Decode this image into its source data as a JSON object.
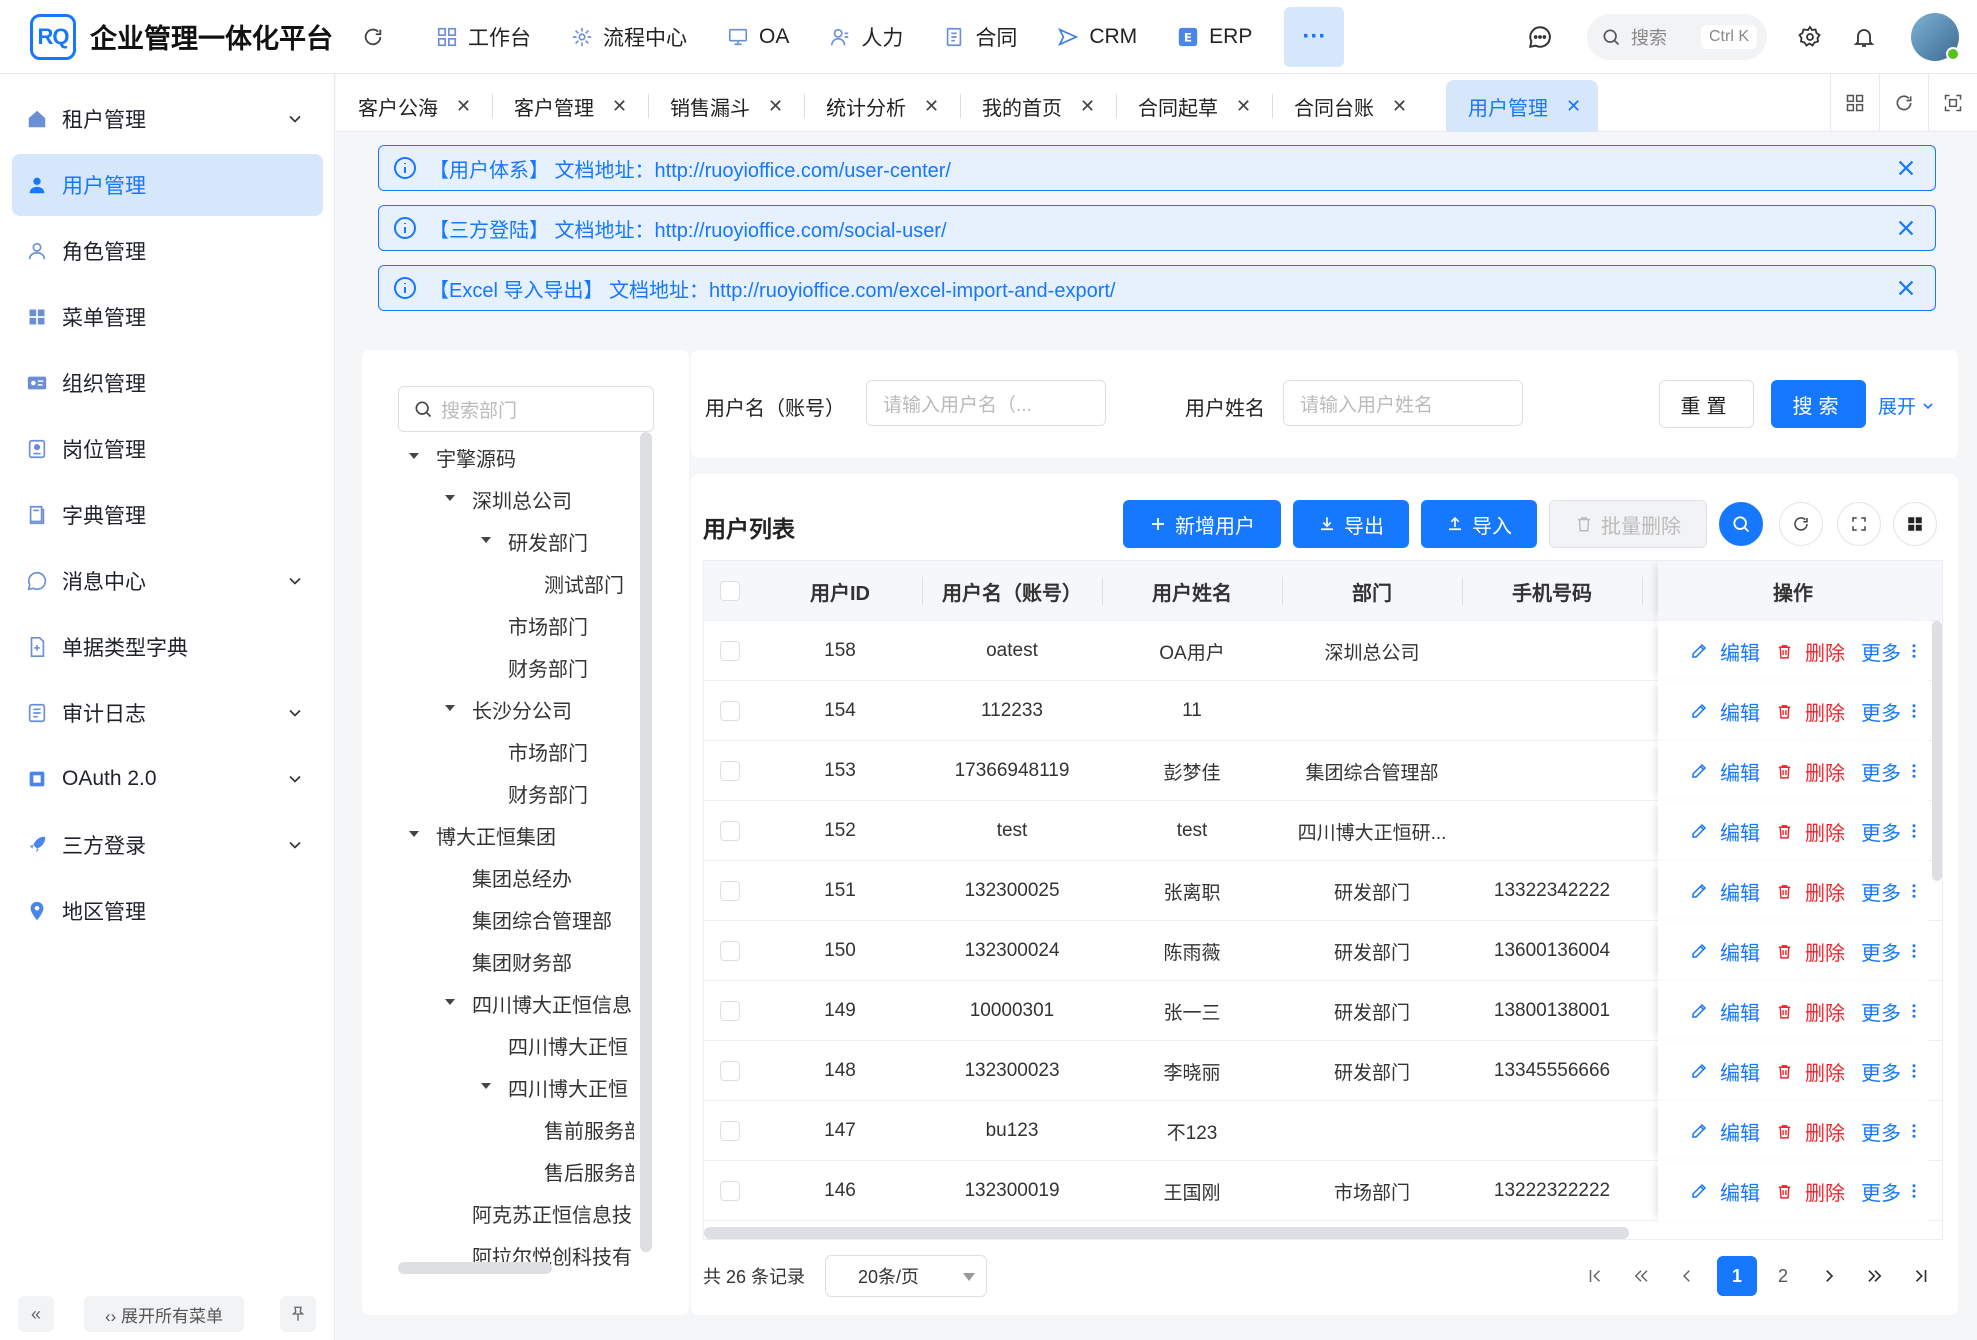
{
  "app": {
    "logo": "RQ",
    "title": "企业管理一体化平台"
  },
  "topnav": [
    {
      "label": "工作台"
    },
    {
      "label": "流程中心"
    },
    {
      "label": "OA"
    },
    {
      "label": "人力"
    },
    {
      "label": "合同"
    },
    {
      "label": "CRM"
    },
    {
      "label": "ERP"
    }
  ],
  "header": {
    "more": "···",
    "search_placeholder": "搜索",
    "search_kbd": "Ctrl K"
  },
  "sidebar": {
    "items": [
      {
        "label": "租户管理"
      },
      {
        "label": "用户管理"
      },
      {
        "label": "角色管理"
      },
      {
        "label": "菜单管理"
      },
      {
        "label": "组织管理"
      },
      {
        "label": "岗位管理"
      },
      {
        "label": "字典管理"
      },
      {
        "label": "消息中心"
      },
      {
        "label": "单据类型字典"
      },
      {
        "label": "审计日志"
      },
      {
        "label": "OAuth 2.0"
      },
      {
        "label": "三方登录"
      },
      {
        "label": "地区管理"
      }
    ],
    "collapse": "«",
    "expand_all": "‹› 展开所有菜单"
  },
  "tabs": [
    {
      "label": "客户公海"
    },
    {
      "label": "客户管理"
    },
    {
      "label": "销售漏斗"
    },
    {
      "label": "统计分析"
    },
    {
      "label": "我的首页"
    },
    {
      "label": "合同起草"
    },
    {
      "label": "合同台账"
    },
    {
      "label": "用户管理"
    }
  ],
  "alerts": [
    {
      "text": "【用户体系】 文档地址：http://ruoyioffice.com/user-center/"
    },
    {
      "text": "【三方登陆】 文档地址：http://ruoyioffice.com/social-user/"
    },
    {
      "text": "【Excel 导入导出】 文档地址：http://ruoyioffice.com/excel-import-and-export/"
    }
  ],
  "tree": {
    "search_placeholder": "搜索部门",
    "nodes": [
      {
        "label": "宇擎源码"
      },
      {
        "label": "深圳总公司"
      },
      {
        "label": "研发部门"
      },
      {
        "label": "测试部门"
      },
      {
        "label": "市场部门"
      },
      {
        "label": "财务部门"
      },
      {
        "label": "长沙分公司"
      },
      {
        "label": "市场部门"
      },
      {
        "label": "财务部门"
      },
      {
        "label": "博大正恒集团"
      },
      {
        "label": "集团总经办"
      },
      {
        "label": "集团综合管理部"
      },
      {
        "label": "集团财务部"
      },
      {
        "label": "四川博大正恒信息"
      },
      {
        "label": "四川博大正恒"
      },
      {
        "label": "四川博大正恒"
      },
      {
        "label": "售前服务部"
      },
      {
        "label": "售后服务部"
      },
      {
        "label": "阿克苏正恒信息技"
      },
      {
        "label": "阿拉尔悦创科技有"
      }
    ]
  },
  "search": {
    "username_label": "用户名（账号）",
    "username_placeholder": "请输入用户名（...",
    "name_label": "用户姓名",
    "name_placeholder": "请输入用户姓名",
    "reset": "重置",
    "search": "搜索",
    "expand": "展开"
  },
  "table": {
    "title": "用户列表",
    "add": "新增用户",
    "export": "导出",
    "import": "导入",
    "batch_delete": "批量删除",
    "columns": [
      "用户ID",
      "用户名（账号）",
      "用户姓名",
      "部门",
      "手机号码",
      "操作"
    ],
    "ops": {
      "edit": "编辑",
      "delete": "删除",
      "more": "更多"
    },
    "rows": [
      {
        "id": "158",
        "username": "oatest",
        "name": "OA用户",
        "dept": "深圳总公司",
        "phone": ""
      },
      {
        "id": "154",
        "username": "112233",
        "name": "11",
        "dept": "",
        "phone": ""
      },
      {
        "id": "153",
        "username": "17366948119",
        "name": "彭梦佳",
        "dept": "集团综合管理部",
        "phone": ""
      },
      {
        "id": "152",
        "username": "test",
        "name": "test",
        "dept": "四川博大正恒研...",
        "phone": ""
      },
      {
        "id": "151",
        "username": "132300025",
        "name": "张离职",
        "dept": "研发部门",
        "phone": "13322342222"
      },
      {
        "id": "150",
        "username": "132300024",
        "name": "陈雨薇",
        "dept": "研发部门",
        "phone": "13600136004"
      },
      {
        "id": "149",
        "username": "10000301",
        "name": "张一三",
        "dept": "研发部门",
        "phone": "13800138001"
      },
      {
        "id": "148",
        "username": "132300023",
        "name": "李晓丽",
        "dept": "研发部门",
        "phone": "13345556666"
      },
      {
        "id": "147",
        "username": "bu123",
        "name": "不123",
        "dept": "",
        "phone": ""
      },
      {
        "id": "146",
        "username": "132300019",
        "name": "王国刚",
        "dept": "市场部门",
        "phone": "13222322222"
      }
    ]
  },
  "pager": {
    "total": "共 26 条记录",
    "page_size": "20条/页",
    "pages": [
      "1",
      "2"
    ]
  }
}
